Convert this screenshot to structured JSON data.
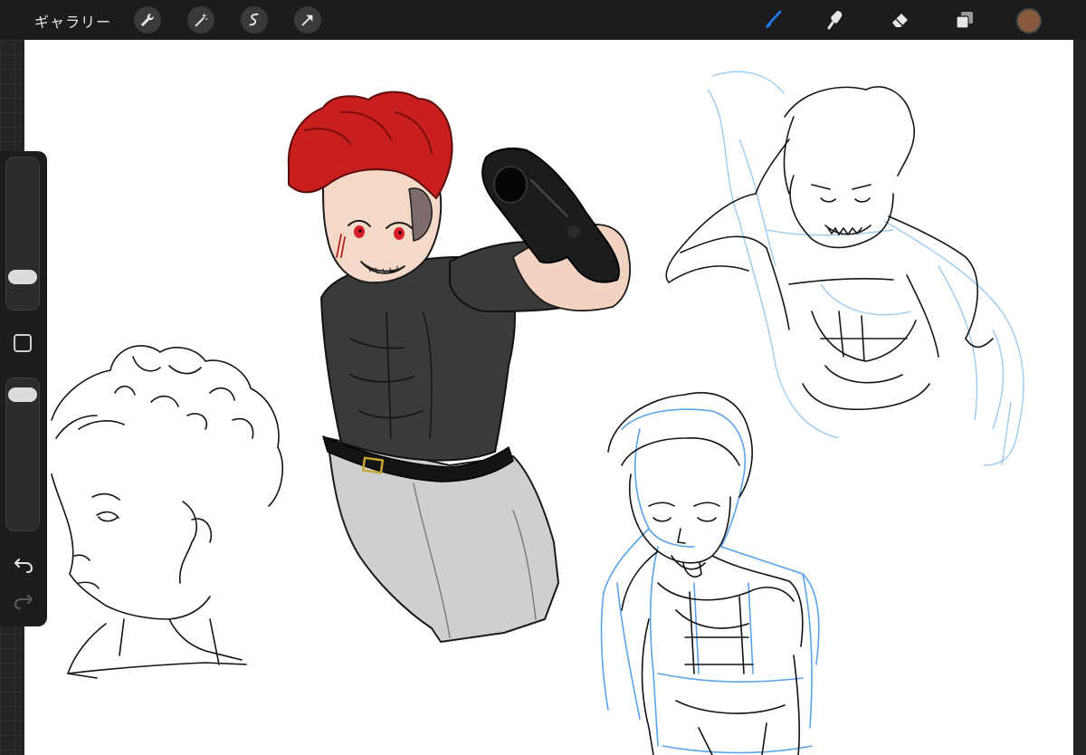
{
  "toolbar": {
    "gallery_label": "ギャラリー",
    "left_tools": [
      "wrench-icon",
      "magic-wand-icon",
      "selection-icon",
      "transform-arrow-icon"
    ],
    "right_tools": [
      "brush-icon",
      "smudge-icon",
      "eraser-icon",
      "layers-icon"
    ],
    "active_tool": "brush-icon",
    "current_color": "#8a5a3c",
    "active_tool_color": "#1e7cf2"
  },
  "sidebar": {
    "brush_size_level": 0.17,
    "opacity_level": 0.95,
    "modifier_button": "square-modifier-icon",
    "undo": "undo-icon",
    "redo": "redo-icon"
  },
  "canvas": {
    "content": "sketch-artwork",
    "figures": [
      "curly-hair-profile-sketch",
      "red-hair-character-with-gun",
      "blue-sketch-figure-top-right",
      "blue-sketch-figure-bottom"
    ]
  }
}
